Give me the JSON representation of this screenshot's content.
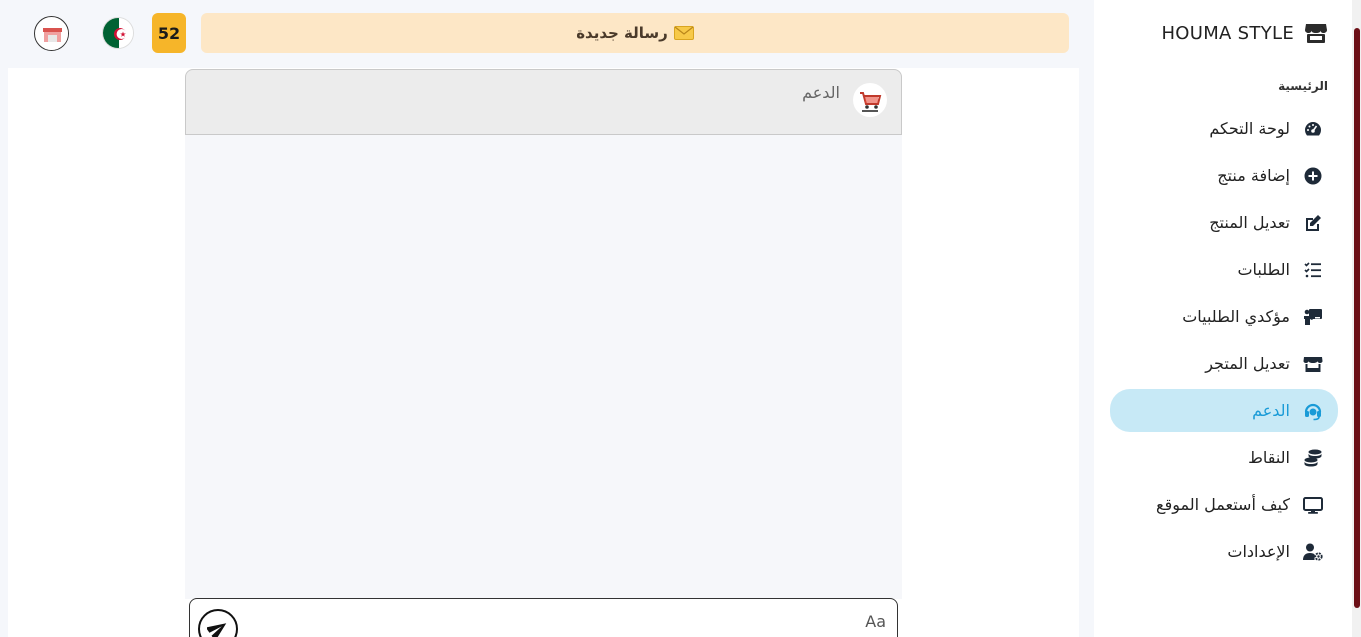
{
  "brand": {
    "name": "HOUMA STYLE",
    "icon": "store-icon"
  },
  "sidebar": {
    "section_title": "الرئيسية",
    "items": [
      {
        "label": "لوحة التحكم",
        "icon": "gauge-icon",
        "active": false
      },
      {
        "label": "إضافة منتج",
        "icon": "plus-circle-icon",
        "active": false
      },
      {
        "label": "تعديل المنتج",
        "icon": "edit-icon",
        "active": false
      },
      {
        "label": "الطلبات",
        "icon": "list-check-icon",
        "active": false
      },
      {
        "label": "مؤكدي الطلبيات",
        "icon": "person-chalkboard-icon",
        "active": false
      },
      {
        "label": "تعديل المتجر",
        "icon": "shop-icon",
        "active": false
      },
      {
        "label": "الدعم",
        "icon": "headset-icon",
        "active": true
      },
      {
        "label": "النقاط",
        "icon": "coins-icon",
        "active": false
      },
      {
        "label": "كيف أستعمل الموقع",
        "icon": "monitor-icon",
        "active": false
      },
      {
        "label": "الإعدادات",
        "icon": "user-gear-icon",
        "active": false
      }
    ],
    "active_color": "#1a9bd7",
    "active_bg": "#c7e9f6"
  },
  "topbar": {
    "notice_text": "رسالة جديدة",
    "notice_icon": "envelope-icon",
    "points": "52",
    "flag": "algeria-flag",
    "avatar": "store-avatar"
  },
  "chat": {
    "header_name": "الدعم",
    "header_logo": "shop-cart-logo",
    "input_placeholder": "Aa",
    "input_value": "",
    "send_icon": "paper-plane-icon"
  }
}
